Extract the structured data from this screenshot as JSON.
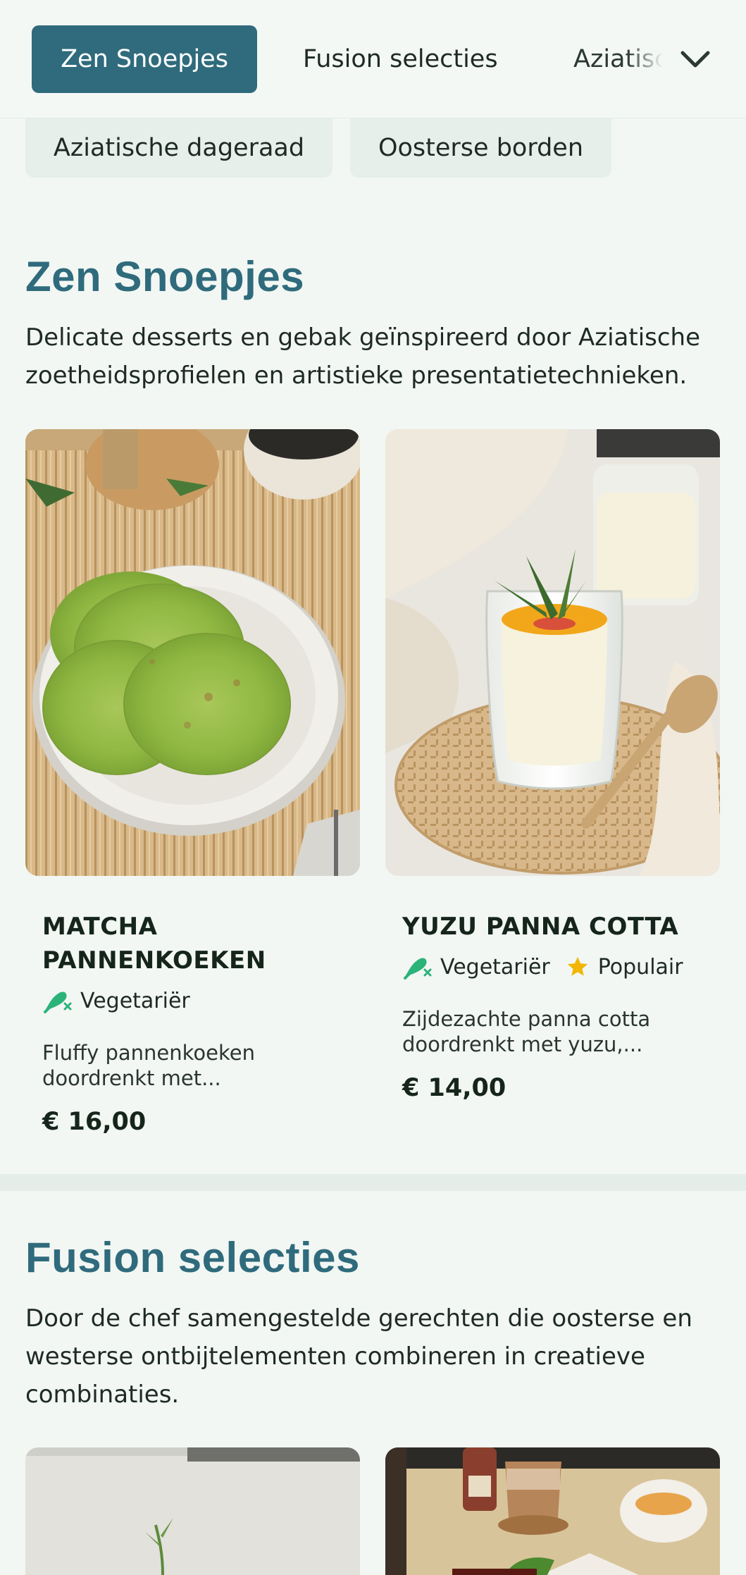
{
  "nav": {
    "tabs": [
      {
        "label": "Zen Snoepjes",
        "active": true
      },
      {
        "label": "Fusion selecties"
      },
      {
        "label": "Aziatische dageraad"
      }
    ],
    "chips": [
      "Aziatische dageraad",
      "Oosterse borden"
    ],
    "expand_icon": "chevron-down-icon"
  },
  "colors": {
    "accent": "#2f6b7c",
    "vegetarian": "#2bb37a",
    "popular": "#f2b705"
  },
  "sections": [
    {
      "title": "Zen Snoepjes",
      "description": "Delicate desserts en gebak geïnspireerd door Aziatische zoetheidsprofielen en artistieke presentatietechnieken.",
      "items": [
        {
          "name": "MATCHA PANNENKOEKEN",
          "tags": [
            "Vegetariër"
          ],
          "description": "Fluffy pannenkoeken doordrenkt met...",
          "price": "€ 16,00",
          "image": "matcha-pancakes-photo"
        },
        {
          "name": "YUZU PANNA COTTA",
          "tags": [
            "Vegetariër",
            "Populair"
          ],
          "description": "Zijdezachte panna cotta doordrenkt met yuzu,...",
          "price": "€ 14,00",
          "image": "yuzu-panna-cotta-photo"
        }
      ]
    },
    {
      "title": "Fusion selecties",
      "description": "Door de chef samengestelde gerechten die oosterse en westerse ontbijtelementen combineren in creatieve combinaties.",
      "items": [
        {
          "image": "fusion-dish-photo-1"
        },
        {
          "image": "fusion-dish-photo-2"
        }
      ]
    }
  ]
}
